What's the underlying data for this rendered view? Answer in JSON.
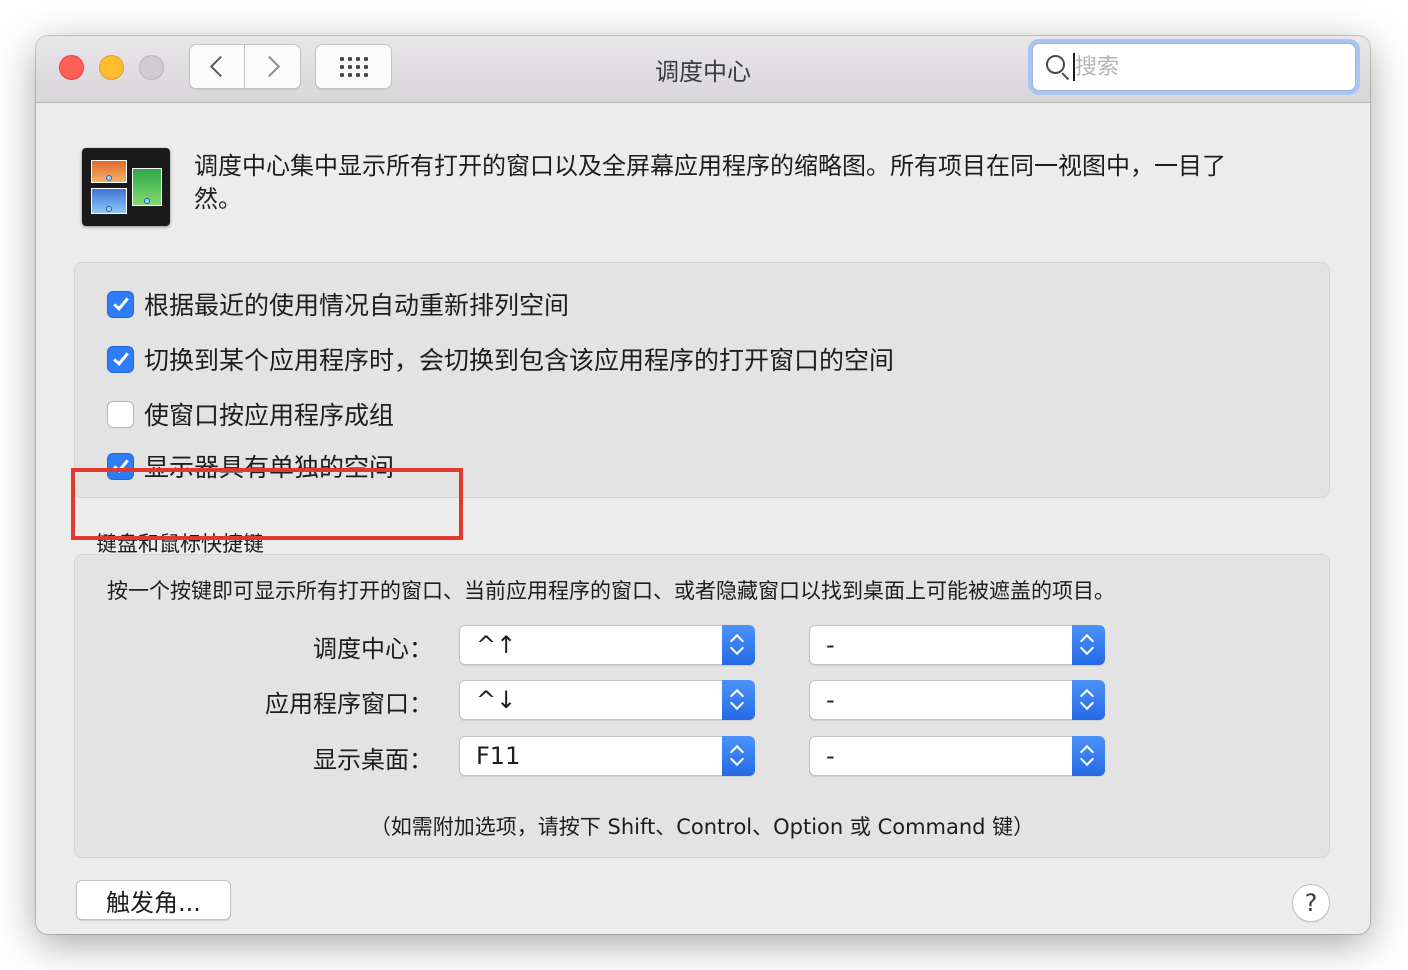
{
  "window": {
    "title": "调度中心",
    "search": {
      "placeholder": "搜索",
      "value": ""
    },
    "nav": {
      "back_icon": "chevron-left-icon",
      "forward_icon": "chevron-right-icon",
      "grid_icon": "grid-icon"
    }
  },
  "header": {
    "icon": "mission-control-icon",
    "description": "调度中心集中显示所有打开的窗口以及全屏幕应用程序的缩略图。所有项目在同一视图中，一目了然。"
  },
  "options": [
    {
      "label": "根据最近的使用情况自动重新排列空间",
      "checked": true
    },
    {
      "label": "切换到某个应用程序时，会切换到包含该应用程序的打开窗口的空间",
      "checked": true
    },
    {
      "label": "使窗口按应用程序成组",
      "checked": false
    },
    {
      "label": "显示器具有单独的空间",
      "checked": true
    }
  ],
  "shortcuts": {
    "section_title": "键盘和鼠标快捷键",
    "description": "按一个按键即可显示所有打开的窗口、当前应用程序的窗口、或者隐藏窗口以找到桌面上可能被遮盖的项目。",
    "rows": [
      {
        "label": "调度中心：",
        "key": "^↑",
        "mouse": "-"
      },
      {
        "label": "应用程序窗口：",
        "key": "^↓",
        "mouse": "-"
      },
      {
        "label": "显示桌面：",
        "key": "F11",
        "mouse": "-"
      }
    ],
    "hint": "（如需附加选项，请按下 Shift、Control、Option 或 Command 键）"
  },
  "footer": {
    "hot_corners_label": "触发角...",
    "help_label": "?"
  },
  "colors": {
    "accent": "#2e7cf6",
    "highlight_box": "#e03a2f"
  }
}
